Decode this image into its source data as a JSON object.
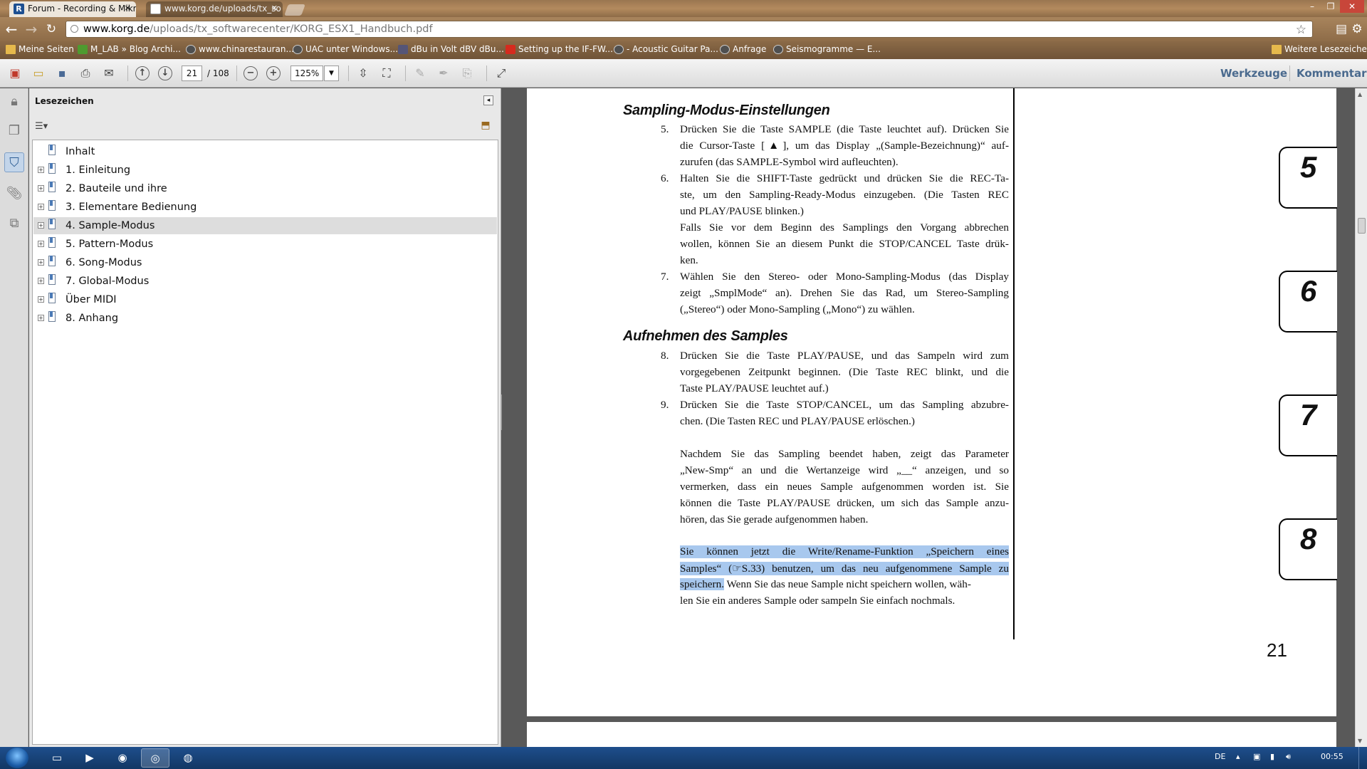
{
  "browser": {
    "tabs": [
      {
        "title": "Forum - Recording & Mikro",
        "favicon": "R",
        "active": true
      },
      {
        "title": "www.korg.de/uploads/tx_so",
        "active": false
      }
    ],
    "url_host": "www.korg.de",
    "url_path": "/uploads/tx_softwarecenter/KORG_ESX1_Handbuch.pdf",
    "bookmarks": [
      {
        "label": "Meine Seiten",
        "icon": "folder-icon"
      },
      {
        "label": "M_LAB » Blog Archi...",
        "icon": "site-icon"
      },
      {
        "label": "www.chinarestauran...",
        "icon": "globe-icon"
      },
      {
        "label": "UAC unter Windows...",
        "icon": "globe-icon"
      },
      {
        "label": "dBu in Volt dBV dBu...",
        "icon": "mixer-icon"
      },
      {
        "label": "Setting up the IF-FW...",
        "icon": "youtube-icon"
      },
      {
        "label": "- Acoustic Guitar Pa...",
        "icon": "globe-icon"
      },
      {
        "label": "Anfrage",
        "icon": "globe-icon"
      },
      {
        "label": "Seismogramme — E...",
        "icon": "globe-icon"
      }
    ],
    "other_bookmarks": "Weitere Lesezeichen"
  },
  "acrobat": {
    "current_page": "21",
    "total_pages": "/ 108",
    "zoom": "125%",
    "tools_link": "Werkzeuge",
    "comment_link": "Kommentar"
  },
  "sidebar": {
    "title": "Lesezeichen",
    "items": [
      {
        "label": "Inhalt",
        "expandable": false,
        "selected": false
      },
      {
        "label": "1. Einleitung",
        "expandable": true,
        "selected": false
      },
      {
        "label": "2. Bauteile und ihre",
        "expandable": true,
        "selected": false
      },
      {
        "label": "3. Elementare Bedienung",
        "expandable": true,
        "selected": false
      },
      {
        "label": "4. Sample-Modus",
        "expandable": true,
        "selected": true
      },
      {
        "label": "5. Pattern-Modus",
        "expandable": true,
        "selected": false
      },
      {
        "label": "6. Song-Modus",
        "expandable": true,
        "selected": false
      },
      {
        "label": "7. Global-Modus",
        "expandable": true,
        "selected": false
      },
      {
        "label": "Über MIDI",
        "expandable": true,
        "selected": false
      },
      {
        "label": "8. Anhang",
        "expandable": true,
        "selected": false
      }
    ]
  },
  "document": {
    "heading1": "Sampling-Modus-Einstellungen",
    "heading2": "Aufnehmen des Samples",
    "nums": [
      "5.",
      "6.",
      "7.",
      "8.",
      "9."
    ],
    "lines": [
      "Drücken Sie die Taste SAMPLE (die Taste leuchtet auf). Drücken Sie",
      "die Cursor-Taste [▲], um das Display „(Sample-Bezeichnung)“ auf-",
      "zurufen (das SAMPLE-Symbol wird aufleuchten).",
      "Halten Sie die SHIFT-Taste gedrückt und drücken Sie die REC-Ta-",
      "ste, um den Sampling-Ready-Modus einzugeben. (Die Tasten REC",
      "und PLAY/PAUSE blinken.)",
      "Falls Sie vor dem Beginn des Samplings den Vorgang abbrechen",
      "wollen, können Sie an diesem Punkt die STOP/CANCEL Taste drük-",
      "ken.",
      "Wählen Sie den Stereo- oder Mono-Sampling-Modus (das Display",
      "zeigt „SmplMode“ an). Drehen Sie das Rad, um Stereo-Sampling",
      "(„Stereo“) oder Mono-Sampling („Mono“) zu wählen.",
      "Drücken Sie die Taste PLAY/PAUSE, und das Sampeln wird zum",
      "vorgegebenen Zeitpunkt beginnen. (Die Taste REC blinkt, und die",
      "Taste PLAY/PAUSE leuchtet auf.)",
      "Drücken Sie die Taste STOP/CANCEL, um das Sampling abzubre-",
      "chen. (Die Tasten REC und PLAY/PAUSE erlöschen.)",
      "Nachdem Sie das Sampling beendet haben, zeigt das Parameter",
      "„New-Smp“ an und die Wertanzeige wird „__“ anzeigen, und so",
      "vermerken, dass ein neues Sample aufgenommen worden ist. Sie",
      "können die Taste PLAY/PAUSE drücken, um sich das Sample anzu-",
      "hören, das Sie gerade aufgenommen haben.",
      "Sie können jetzt die Write/Rename-Funktion „Speichern eines",
      "Samples“ (☞S.33) benutzen, um das neu aufgenommene Sample zu",
      "speichern.",
      " Wenn Sie das neue Sample nicht speichern wollen, wäh-",
      "len Sie ein anderes Sample oder sampeln Sie einfach nochmals."
    ],
    "chapter_tabs": [
      "5",
      "6",
      "7",
      "8"
    ],
    "page_number": "21"
  },
  "taskbar": {
    "language": "DE",
    "clock": "00:55"
  }
}
